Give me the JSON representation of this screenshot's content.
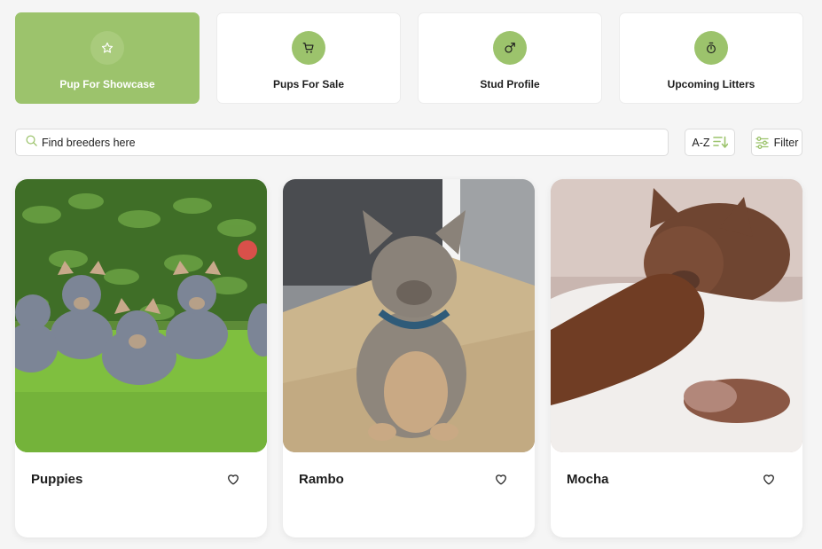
{
  "tabs": [
    {
      "label": "Pup For Showcase",
      "icon": "star-icon",
      "active": true
    },
    {
      "label": "Pups For Sale",
      "icon": "cart-icon",
      "active": false
    },
    {
      "label": "Stud Profile",
      "icon": "male-symbol-icon",
      "active": false
    },
    {
      "label": "Upcoming Litters",
      "icon": "stopwatch-icon",
      "active": false
    }
  ],
  "search": {
    "placeholder": "Find breeders here"
  },
  "sort": {
    "label": "A-Z"
  },
  "filter": {
    "label": "Filter"
  },
  "cards": [
    {
      "name": "Puppies"
    },
    {
      "name": "Rambo"
    },
    {
      "name": "Mocha"
    }
  ],
  "colors": {
    "accent": "#9cc36c",
    "background": "#f5f5f5"
  }
}
